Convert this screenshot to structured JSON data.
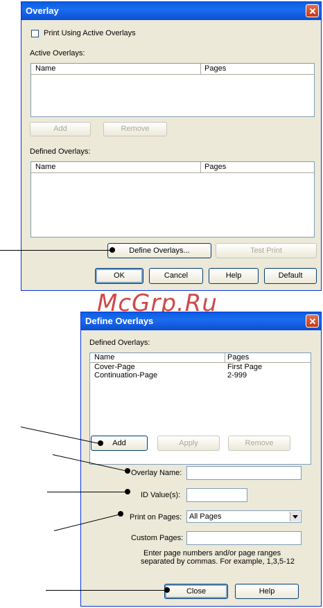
{
  "overlay_dialog": {
    "title": "Overlay",
    "print_active_label": "Print Using Active Overlays",
    "active_overlays_label": "Active Overlays:",
    "active_columns": [
      "Name",
      "Pages"
    ],
    "add_label": "Add",
    "remove_label": "Remove",
    "defined_overlays_label": "Defined Overlays:",
    "defined_columns": [
      "Name",
      "Pages"
    ],
    "define_overlays_label": "Define Overlays...",
    "test_print_label": "Test Print",
    "ok_label": "OK",
    "cancel_label": "Cancel",
    "help_label": "Help",
    "default_label": "Default"
  },
  "watermark": "McGrp.Ru",
  "define_dialog": {
    "title": "Define Overlays",
    "defined_overlays_label": "Defined Overlays:",
    "columns": [
      "Name",
      "Pages"
    ],
    "rows": [
      {
        "name": "Cover-Page",
        "pages": "First Page"
      },
      {
        "name": "Continuation-Page",
        "pages": "2-999"
      }
    ],
    "add_label": "Add",
    "apply_label": "Apply",
    "remove_label": "Remove",
    "overlay_name_label": "Overlay Name:",
    "overlay_name_value": "",
    "id_values_label": "ID Value(s):",
    "id_values_value": "",
    "print_on_pages_label": "Print on Pages:",
    "print_on_pages_value": "All Pages",
    "custom_pages_label": "Custom Pages:",
    "custom_pages_value": "",
    "hint_line1": "Enter page numbers and/or page ranges",
    "hint_line2": "separated by commas. For example, 1,3,5-12",
    "close_label": "Close",
    "help_label": "Help"
  }
}
